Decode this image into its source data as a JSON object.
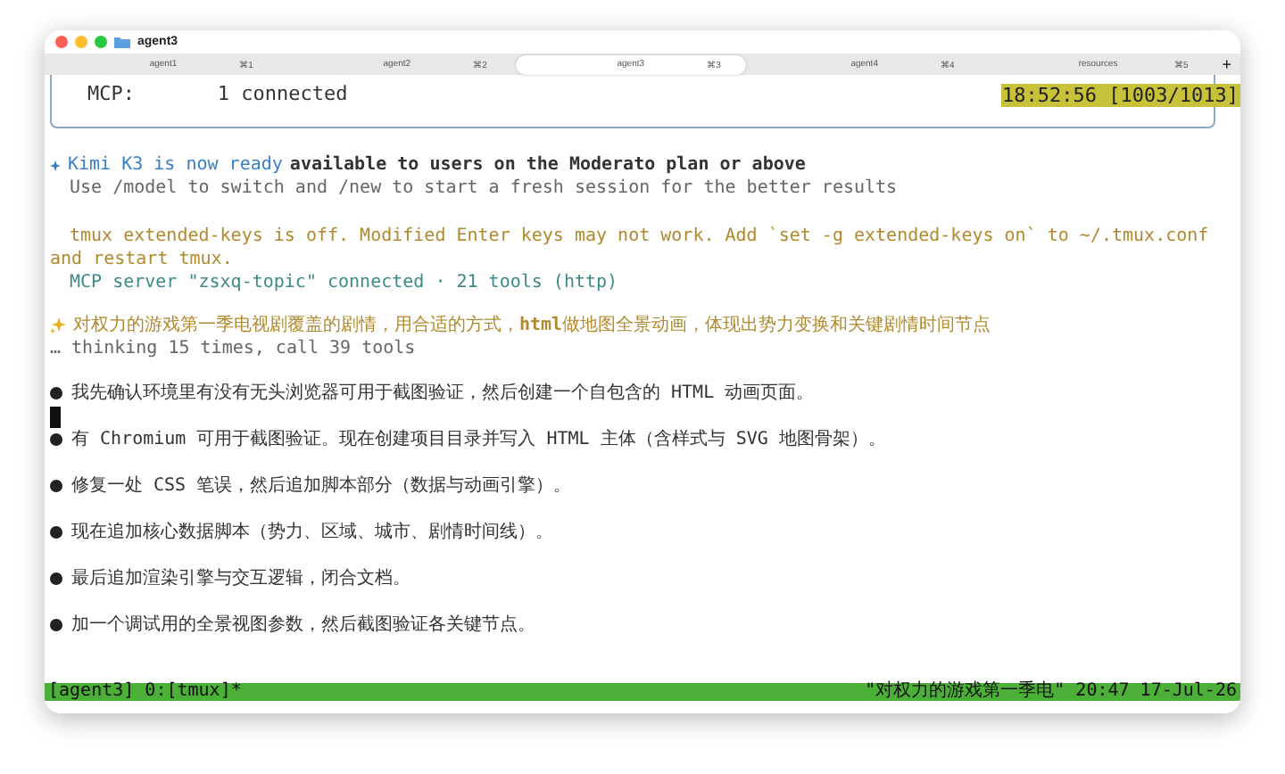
{
  "window": {
    "title": "agent3"
  },
  "tabs": [
    {
      "label": "agent1",
      "shortcut": "⌘1",
      "selected": false
    },
    {
      "label": "agent2",
      "shortcut": "⌘2",
      "selected": false
    },
    {
      "label": "agent3",
      "shortcut": "⌘3",
      "selected": true
    },
    {
      "label": "agent4",
      "shortcut": "⌘4",
      "selected": false
    },
    {
      "label": "resources",
      "shortcut": "⌘5",
      "selected": false
    }
  ],
  "new_tab_button": "+",
  "mcp_box": {
    "label": "MCP:",
    "value": "1 connected"
  },
  "clock": "18:52:56 [1003/1013]",
  "notice": {
    "headline": "Kimi K3 is now ready",
    "text": "available to users on the Moderato plan or above",
    "hint": "Use /model to switch and /new to start a fresh session for the better results"
  },
  "warning": "tmux extended-keys is off. Modified Enter keys may not work. Add `set -g extended-keys on` to ~/.tmux.conf and restart tmux.",
  "mcp_server": "MCP server \"zsxq-topic\" connected · 21 tools (http)",
  "prompt": "对权力的游戏第一季电视剧覆盖的剧情，用合适的方式，**html**做地图全景动画，体现出势力变换和关键剧情时间节点",
  "thinking": "… thinking 15 times, call 39 tools",
  "messages": [
    "我先确认环境里有没有无头浏览器可用于截图验证，然后创建一个自包含的 HTML 动画页面。",
    "有 Chromium 可用于截图验证。现在创建项目目录并写入 HTML 主体（含样式与 SVG 地图骨架）。",
    "修复一处 CSS 笔误，然后追加脚本部分（数据与动画引擎）。",
    "现在追加核心数据脚本（势力、区域、城市、剧情时间线）。",
    "最后追加渲染引擎与交互逻辑，闭合文档。",
    "加一个调试用的全景视图参数，然后截图验证各关键节点。"
  ],
  "status_bar": {
    "left": "[agent3] 0:[tmux]*",
    "right": "\"对权力的游戏第一季电\" 20:47 17-Jul-26"
  }
}
